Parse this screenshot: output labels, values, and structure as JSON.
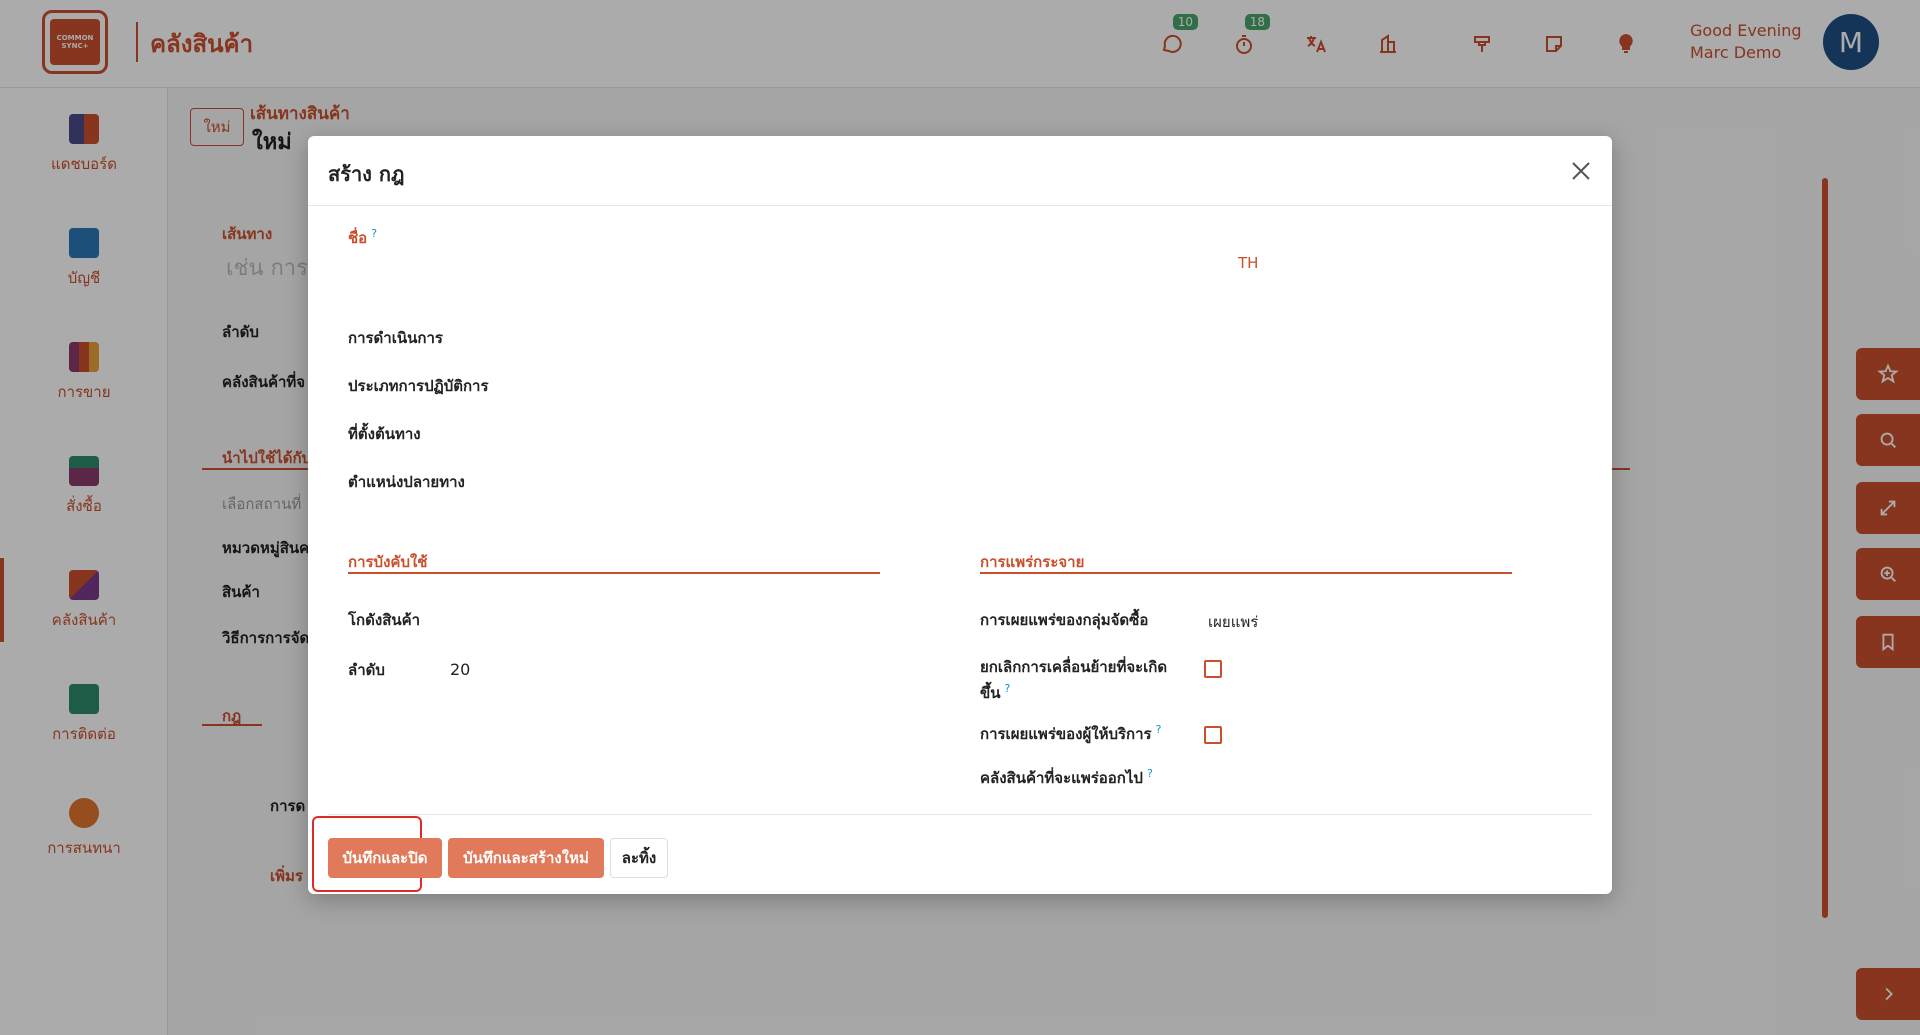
{
  "topbar": {
    "app_title": "คลังสินค้า",
    "logo_text": "COMMON SYNC+",
    "greeting_line1": "Good Evening",
    "greeting_line2": "Marc Demo",
    "avatar_letter": "M",
    "messages_badge": "10",
    "activities_badge": "18",
    "icons": [
      "chat-icon",
      "timer-icon",
      "translate-icon",
      "company-icon",
      "pin-icon",
      "note-icon",
      "bulb-icon"
    ]
  },
  "sidebar": {
    "items": [
      {
        "label": "แดชบอร์ด",
        "icon": "dashboard-icon"
      },
      {
        "label": "บัญชี",
        "icon": "accounting-icon"
      },
      {
        "label": "การขาย",
        "icon": "sales-icon"
      },
      {
        "label": "สั่งซื้อ",
        "icon": "purchase-icon"
      },
      {
        "label": "คลังสินค้า",
        "icon": "inventory-icon"
      },
      {
        "label": "การติดต่อ",
        "icon": "contacts-icon"
      },
      {
        "label": "การสนทนา",
        "icon": "discuss-icon"
      }
    ]
  },
  "background": {
    "new_button": "ใหม่",
    "breadcrumb_parent": "เส้นทางสินค้า",
    "breadcrumb_current": "ใหม่",
    "route_label": "เส้นทาง",
    "route_placeholder": "เช่น การ",
    "sequence_label": "ลำดับ",
    "warehouse_label": "คลังสินค้าที่จ",
    "applicable_on": "นำไปใช้ได้กับ",
    "select_places": "เลือกสถานที่",
    "product_category": "หมวดหมู่สินค",
    "product": "สินค้า",
    "method": "วิธีการการจัด",
    "rules_tab": "กฎ",
    "action_col": "การด",
    "add_line": "เพิ่มร"
  },
  "modal": {
    "title": "สร้าง กฎ",
    "name_label": "ชื่อ",
    "lang_tag": "TH",
    "action_label": "การดำเนินการ",
    "operation_type_label": "ประเภทการปฏิบัติการ",
    "source_location_label": "ที่ตั้งต้นทาง",
    "dest_location_label": "ตำแหน่งปลายทาง",
    "applicability_section": "การบังคับใช้",
    "warehouse_label": "โกดังสินค้า",
    "sequence_label": "ลำดับ",
    "sequence_value": "20",
    "propagation_section": "การแพร่กระจาย",
    "group_propagation_label": "การเผยแพร่ของกลุ่มจัดซื้อ",
    "group_propagation_value": "เผยแพร่",
    "cancel_moves_label_1": "ยกเลิกการเคลื่อนย้ายที่จะเกิด",
    "cancel_moves_label_2": "ขึ้น",
    "carrier_propagation_label": "การเผยแพร่ของผู้ให้บริการ",
    "warehouse_to_propagate_label": "คลังสินค้าที่จะแพร่ออกไป",
    "save_close_button": "บันทึกและปิด",
    "save_new_button": "บันทึกและสร้างใหม่",
    "discard_button": "ละทิ้ง"
  },
  "colors": {
    "accent": "#c9502d",
    "primary_button": "#e07a5a",
    "badge": "#4aa36b",
    "avatar": "#1f4f82",
    "highlight": "#e02a2a"
  }
}
